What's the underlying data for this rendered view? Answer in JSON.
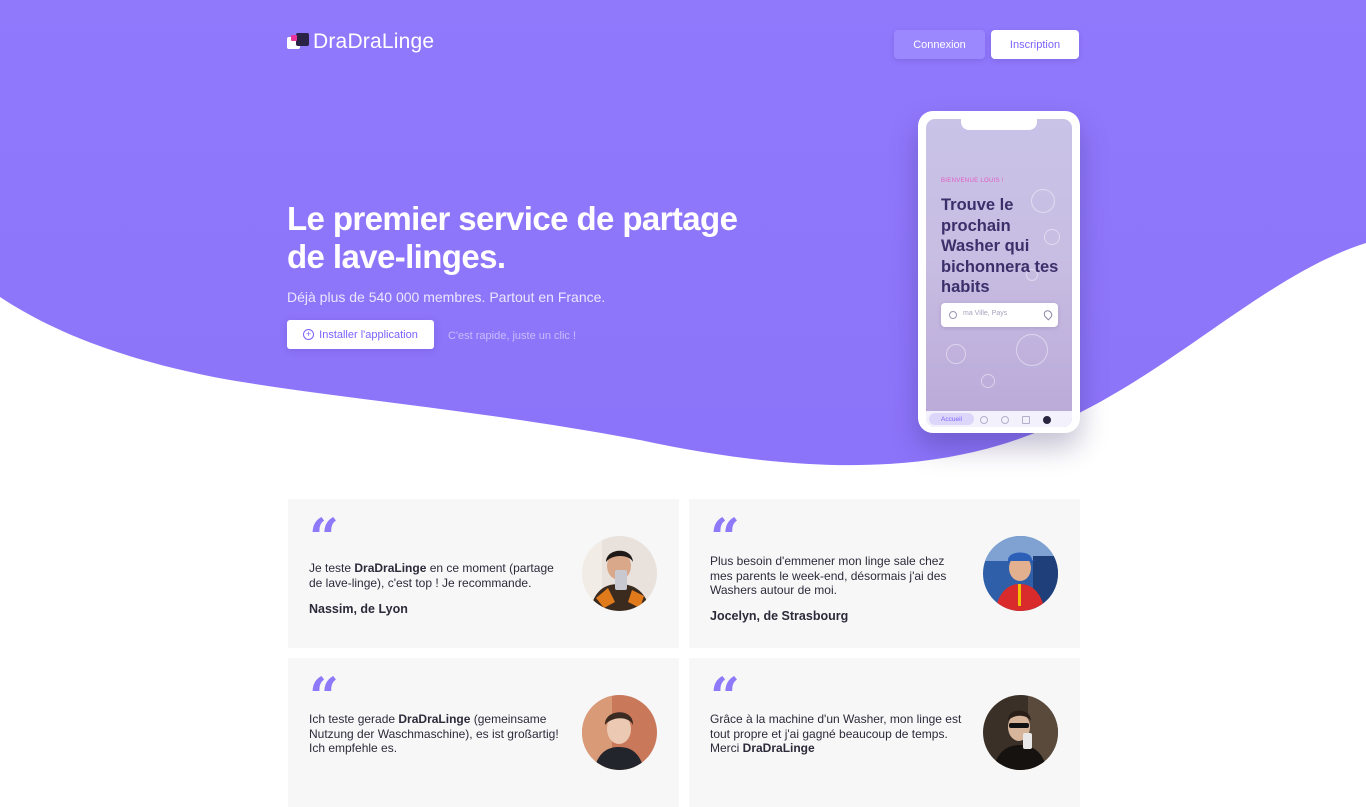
{
  "header": {
    "logo_text": "DraDraLinge",
    "login_label": "Connexion",
    "signup_label": "Inscription"
  },
  "hero": {
    "title_line1": "Le premier service de partage",
    "title_line2": "de lave-linges.",
    "subtitle": "Déjà plus de 540 000 membres. Partout en France.",
    "install_label": "Installer l'application",
    "install_hint": "C'est rapide, juste un clic !"
  },
  "phone": {
    "welcome": "BIENVENUE LOUIS !",
    "heading": "Trouve le prochain Washer qui bichonnera tes habits",
    "search_placeholder": "ma Ville, Pays",
    "tab_home": "Accueil"
  },
  "testimonials": [
    {
      "text_before": "Je teste ",
      "brand": "DraDraLinge",
      "text_after": " en ce moment (partage de lave-linge), c'est top ! Je recommande.",
      "author": "Nassim, de Lyon"
    },
    {
      "text_before": "Plus besoin d'emmener mon linge sale chez mes parents le week-end, désormais j'ai des Washers autour de moi.",
      "brand": "",
      "text_after": "",
      "author": "Jocelyn, de Strasbourg"
    },
    {
      "text_before": "Ich teste gerade ",
      "brand": "DraDraLinge",
      "text_after": " (gemeinsame Nutzung der Waschmaschine), es ist großartig! Ich empfehle es.",
      "author": ""
    },
    {
      "text_before": "Grâce à la machine d'un Washer, mon linge est tout propre et j'ai gagné beaucoup de temps. Merci ",
      "brand": "DraDraLinge",
      "text_after": "",
      "author": ""
    }
  ],
  "colors": {
    "brand_purple": "#8f78fd",
    "accent_pink": "#e7359c",
    "quote_purple": "#8e79f8",
    "card_bg": "#f7f7f7"
  }
}
